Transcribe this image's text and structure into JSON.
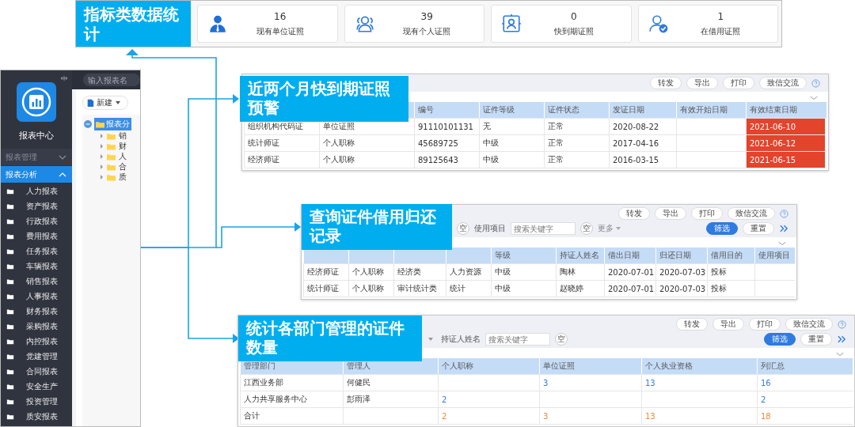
{
  "stats": {
    "title": "指标类数据统计",
    "cards": [
      {
        "value": "16",
        "label": "现有单位证照"
      },
      {
        "value": "39",
        "label": "现有个人证照"
      },
      {
        "value": "0",
        "label": "快到期证照"
      },
      {
        "value": "1",
        "label": "在借用证照"
      }
    ]
  },
  "app": {
    "logo_title": "报表中心",
    "search": {
      "placeholder": "输入报表名"
    },
    "new_button": "新建",
    "sections": [
      {
        "label": "报表管理",
        "expanded": false
      },
      {
        "label": "报表分析",
        "expanded": true
      }
    ],
    "menu_items": [
      "人力报表",
      "资产报表",
      "行政报表",
      "费用报表",
      "任务报表",
      "车辆报表",
      "销售报表",
      "人事报表",
      "财务报表",
      "采购报表",
      "内控报表",
      "党建管理",
      "合同报表",
      "安全生产",
      "投资管理",
      "质安报表"
    ],
    "tree": {
      "label": "报表分",
      "selected": true,
      "expanded": true,
      "children": [
        {
          "label": "销"
        },
        {
          "label": "财"
        },
        {
          "label": "人"
        },
        {
          "label": "合"
        },
        {
          "label": "质"
        }
      ]
    }
  },
  "panels": [
    {
      "kind": "expiry",
      "caption": "近两个月快到期证照预警",
      "buttons": [
        "转发",
        "导出",
        "打印",
        "致信交流"
      ],
      "columns": [
        null,
        null,
        "编号",
        "证件等级",
        "证件状态",
        "发证日期",
        "有效开始日期",
        "有效结束日期"
      ],
      "rows": [
        {
          "expiring": true,
          "cells": [
            "组织机构代码证",
            "单位证照",
            "91110101131",
            "无",
            "正常",
            "2020-08-22",
            null,
            "2021-06-10"
          ]
        },
        {
          "expiring": true,
          "cells": [
            "统计师证",
            "个人职称",
            "45689725",
            "中级",
            "正常",
            "2017-04-16",
            null,
            "2021-06-12"
          ]
        },
        {
          "expiring": true,
          "cells": [
            "经济师证",
            "个人职称",
            "89125643",
            "中级",
            "正常",
            "2016-03-15",
            null,
            "2021-06-15"
          ]
        }
      ]
    },
    {
      "kind": "borrow",
      "caption": "查询证件借用归还记录",
      "buttons": [
        "转发",
        "导出",
        "打印",
        "致信交流"
      ],
      "filters": [
        {
          "kind": "clear",
          "text": "空"
        },
        {
          "kind": "label",
          "text": "使用项目"
        },
        {
          "kind": "field",
          "placeholder": "搜索关键字"
        },
        {
          "kind": "clear",
          "text": "空"
        },
        {
          "kind": "more",
          "text": "更多"
        }
      ],
      "filter_buttons": [
        {
          "label": "筛选",
          "primary": true
        },
        {
          "label": "重置",
          "primary": false
        }
      ],
      "columns": [
        null,
        null,
        null,
        null,
        "等级",
        "持证人姓名",
        "借出日期",
        "归还日期",
        "借用目的",
        "使用项目"
      ],
      "rows": [
        {
          "cells": [
            "经济师证",
            "个人职称",
            "经济类",
            "人力资源",
            "中级",
            "陶林",
            "2020-07-01",
            "2020-07-03",
            "投标",
            null
          ]
        },
        {
          "cells": [
            "统计师证",
            "个人职称",
            "审计统计类",
            "统计",
            "中级",
            "赵晓婷",
            "2020-07-01",
            "2020-07-03",
            "投标",
            null
          ]
        }
      ]
    },
    {
      "kind": "summary",
      "caption": "统计各部门管理的证件数量",
      "buttons": [
        "转发",
        "导出",
        "打印",
        "致信交流"
      ],
      "filters": [
        {
          "kind": "select"
        },
        {
          "kind": "label",
          "text": "持证人姓名"
        },
        {
          "kind": "field",
          "placeholder": "搜索关键字"
        },
        {
          "kind": "clear",
          "text": "空"
        }
      ],
      "filter_buttons": [
        {
          "label": "筛选",
          "primary": true
        },
        {
          "label": "重置",
          "primary": false
        }
      ],
      "columns": [
        "管理部门",
        "管理人",
        "个人职称",
        "单位证照",
        "个人执业资格",
        "列汇总"
      ],
      "rows": [
        {
          "kind": "data",
          "cells": [
            "江西业务部",
            "何健民",
            null,
            "3",
            "13",
            "16"
          ]
        },
        {
          "kind": "data",
          "cells": [
            "人力共享服务中心",
            "彭雨泽",
            "2",
            null,
            null,
            "2"
          ]
        },
        {
          "kind": "total",
          "cells": [
            "合计",
            null,
            "2",
            "3",
            "13",
            "18"
          ]
        }
      ]
    }
  ]
}
